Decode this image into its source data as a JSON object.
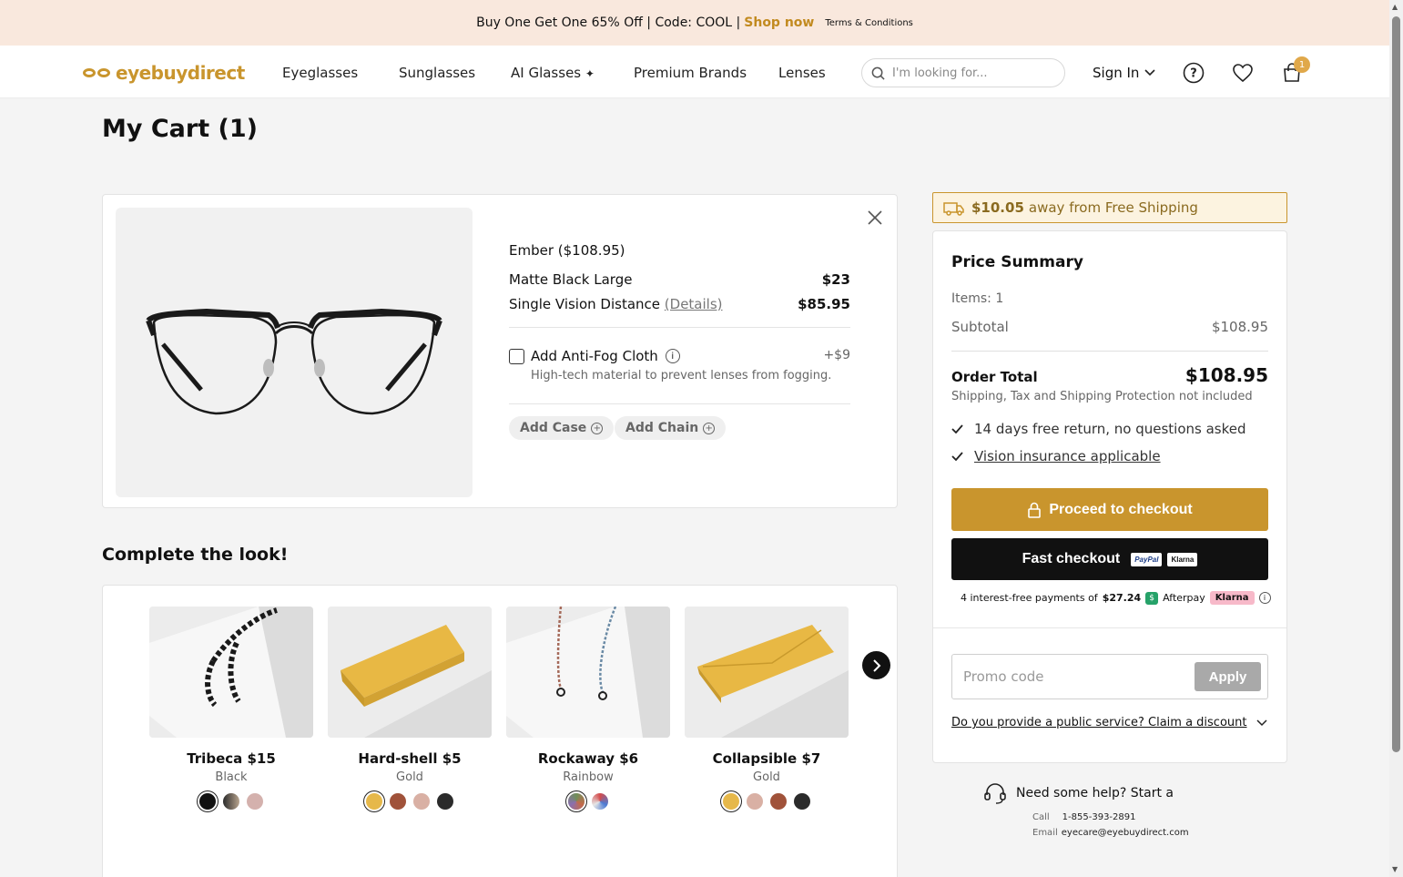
{
  "promo_bar": {
    "text": "Buy One Get One 65% Off | Code: COOL |",
    "shop_now": "Shop now",
    "terms": "Terms & Conditions"
  },
  "header": {
    "logo": "eyebuydirect",
    "nav": [
      "Eyeglasses",
      "Sunglasses",
      "AI Glasses",
      "Premium Brands",
      "Lenses"
    ],
    "search_placeholder": "I'm looking for...",
    "sign_in": "Sign In",
    "cart_count": "1"
  },
  "page_title": "My Cart (1)",
  "cart_item": {
    "name": "Ember ($108.95)",
    "lines": [
      {
        "label": "Matte Black Large",
        "price": "$23"
      },
      {
        "label": "Single Vision Distance",
        "link": "(Details)",
        "price": "$85.95"
      }
    ],
    "antifog": {
      "label": "Add Anti-Fog Cloth",
      "price": "+$9",
      "desc": "High-tech material to prevent lenses from fogging."
    },
    "add_case": "Add Case",
    "add_chain": "Add Chain"
  },
  "complete_look": {
    "title": "Complete the look!",
    "items": [
      {
        "name": "Tribeca $15",
        "color": "Black",
        "swatches": [
          "#111111",
          "#6b5a4a",
          "#d4b1ad"
        ]
      },
      {
        "name": "Hard-shell $5",
        "color": "Gold",
        "swatches": [
          "#e6b84a",
          "#a0523a",
          "#d9b0a4",
          "#2b2b2b"
        ]
      },
      {
        "name": "Rockaway $6",
        "color": "Rainbow",
        "swatches": [
          "#6f8f5a",
          "#d44b4b"
        ]
      },
      {
        "name": "Collapsible $7",
        "color": "Gold",
        "swatches": [
          "#e6b84a",
          "#d9b0a4",
          "#a0523a",
          "#2b2b2b"
        ]
      }
    ]
  },
  "shipping_banner": {
    "amount": "$10.05",
    "text": "away from Free Shipping"
  },
  "summary": {
    "title": "Price Summary",
    "items": "Items: 1",
    "subtotal_label": "Subtotal",
    "subtotal_value": "$108.95",
    "order_total_label": "Order Total",
    "order_total_value": "$108.95",
    "note": "Shipping, Tax and Shipping Protection not included",
    "benefits": [
      "14 days free return, no questions asked",
      "Vision insurance applicable"
    ],
    "checkout": "Proceed to checkout",
    "fast_checkout": "Fast checkout",
    "paypal": "PayPal",
    "klarna": "Klarna",
    "installments_text": "4 interest-free payments of",
    "installments_amount": "$27.24",
    "afterpay": "Afterpay",
    "promo_placeholder": "Promo code",
    "apply": "Apply",
    "claim": "Do you provide a public service? Claim a discount"
  },
  "help": {
    "title": "Need some help? Start a",
    "call_label": "Call",
    "call_value": "1-855-393-2891",
    "email_label": "Email",
    "email_value": "eyecare@eyebuydirect.com"
  },
  "colors": {
    "accent": "#c9952d",
    "promo_bg": "#f9e8dd",
    "dark": "#111111"
  }
}
